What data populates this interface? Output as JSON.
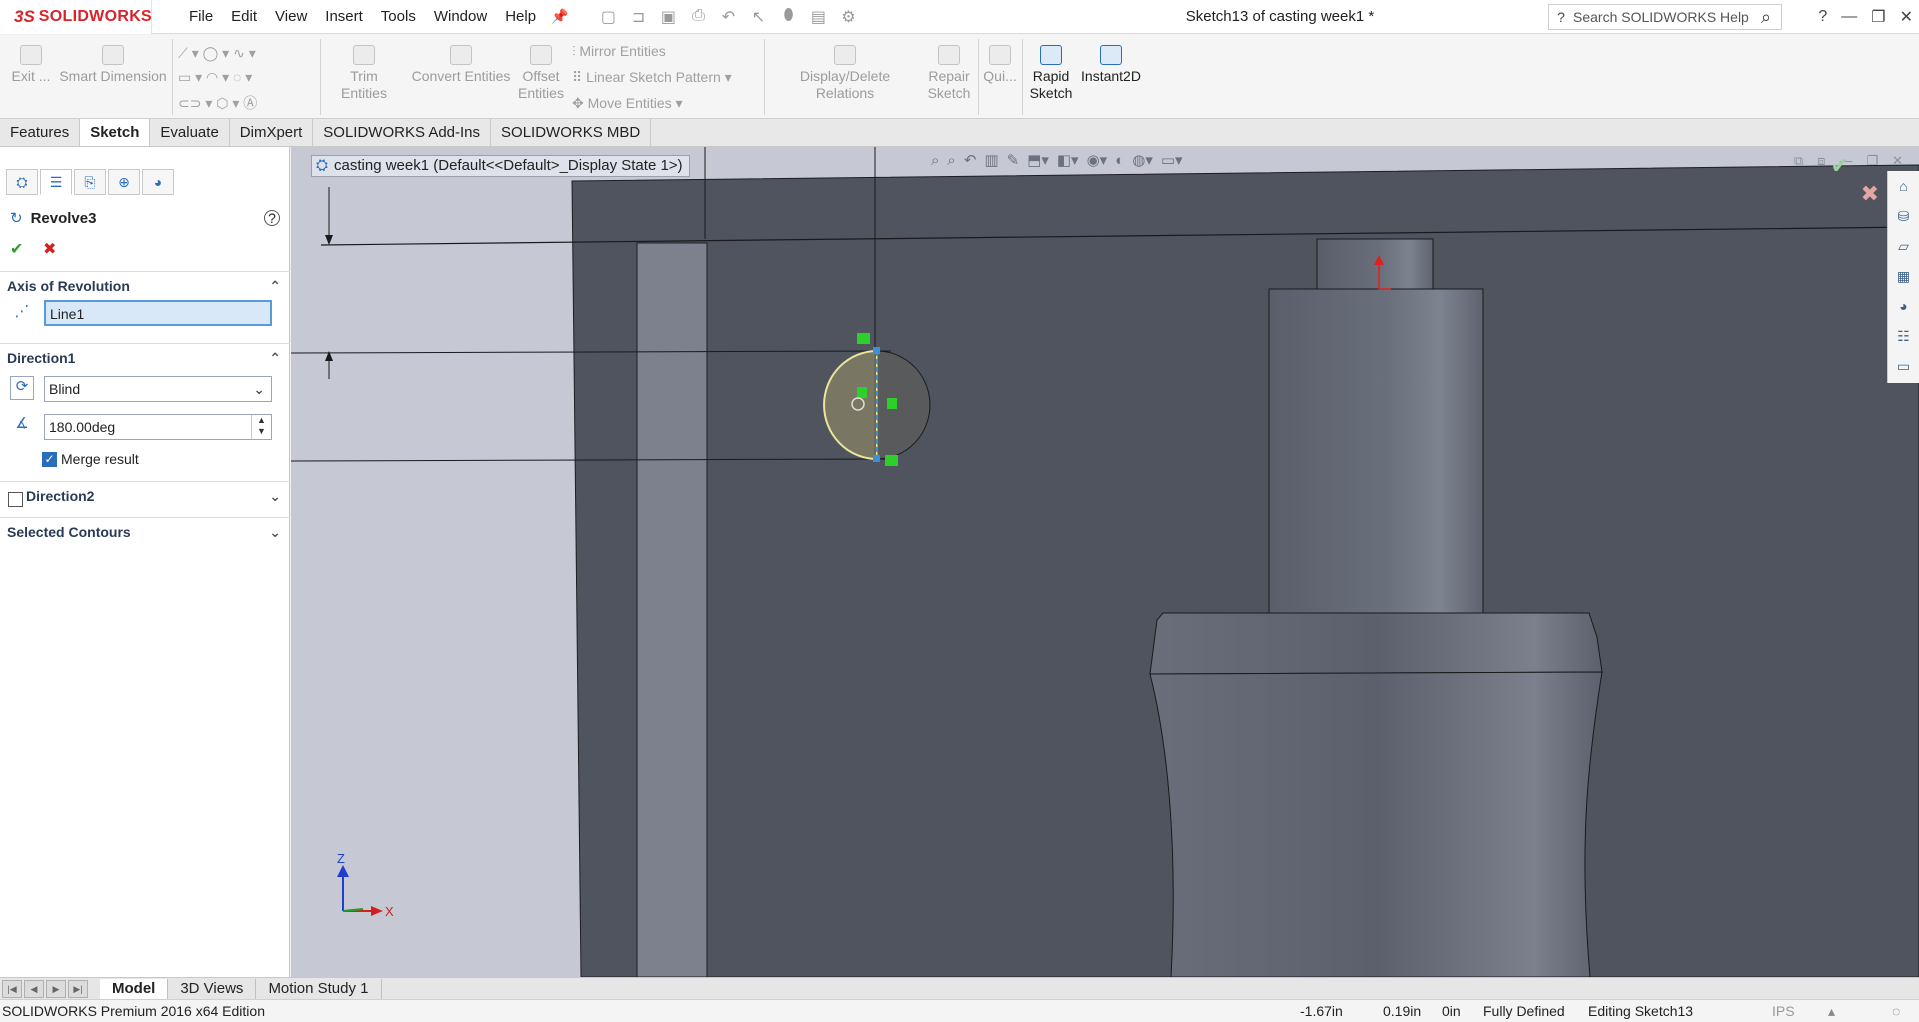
{
  "app": {
    "logo": "SOLIDWORKS",
    "document_title": "Sketch13 of casting week1 *",
    "search_placeholder": "Search SOLIDWORKS Help"
  },
  "menu": [
    "File",
    "Edit",
    "View",
    "Insert",
    "Tools",
    "Window",
    "Help"
  ],
  "ribbon": {
    "exit": "Exit ...",
    "smart_dimension": "Smart Dimension",
    "trim": "Trim Entities",
    "convert": "Convert Entities",
    "offset_line1": "Offset",
    "offset_line2": "Entities",
    "mirror": "Mirror Entities",
    "linear_pattern": "Linear Sketch Pattern",
    "move": "Move Entities",
    "display_relations": "Display/Delete Relations",
    "repair_line1": "Repair",
    "repair_line2": "Sketch",
    "quick": "Qui...",
    "rapid_line1": "Rapid",
    "rapid_line2": "Sketch",
    "instant2d": "Instant2D"
  },
  "tabs": [
    "Features",
    "Sketch",
    "Evaluate",
    "DimXpert",
    "SOLIDWORKS Add-Ins",
    "SOLIDWORKS MBD"
  ],
  "active_tab": "Sketch",
  "property_manager": {
    "title": "Revolve3",
    "axis_group": "Axis of Revolution",
    "axis_value": "Line1",
    "direction1_group": "Direction1",
    "end_condition": "Blind",
    "angle": "180.00deg",
    "merge_result": "Merge result",
    "direction2": "Direction2",
    "selected_contours": "Selected Contours"
  },
  "graphics": {
    "breadcrumb": "casting week1  (Default<<Default>_Display State 1>)",
    "triad_z": "Z",
    "triad_x": "X"
  },
  "bottom_tabs": [
    "Model",
    "3D Views",
    "Motion Study 1"
  ],
  "status": {
    "edition": "SOLIDWORKS Premium 2016 x64 Edition",
    "x": "-1.67in",
    "y": "0.19in",
    "z": "0in",
    "state": "Fully Defined",
    "editing": "Editing Sketch13",
    "units": "IPS"
  },
  "colors": {
    "model_dark": "#50545f",
    "background": "#c6c9d3",
    "sketch_circle": "#e8e0a0",
    "accent": "#2a6ebb"
  }
}
